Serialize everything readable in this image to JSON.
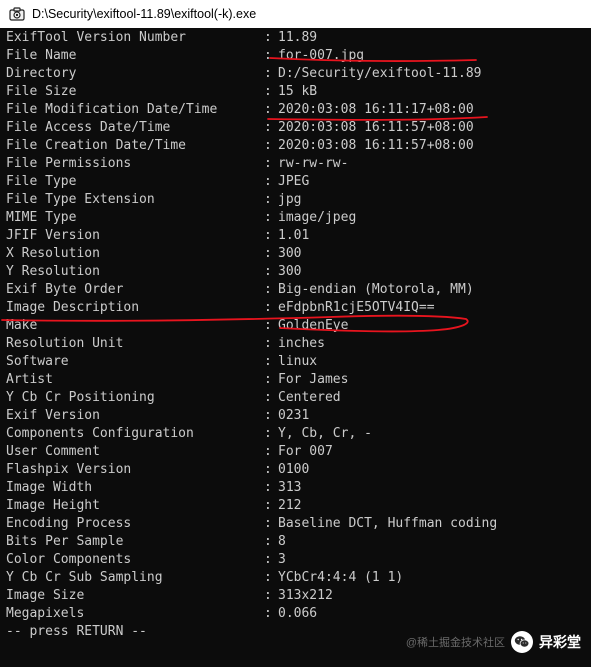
{
  "window": {
    "title": "D:\\Security\\exiftool-11.89\\exiftool(-k).exe",
    "icon": "camera-icon"
  },
  "console": {
    "background": "#0c0c0c",
    "text_color": "#cccccc",
    "separator": ":",
    "rows": [
      {
        "key": "ExifTool Version Number",
        "value": "11.89"
      },
      {
        "key": "File Name",
        "value": "for-007.jpg"
      },
      {
        "key": "Directory",
        "value": "D:/Security/exiftool-11.89"
      },
      {
        "key": "File Size",
        "value": "15 kB"
      },
      {
        "key": "File Modification Date/Time",
        "value": "2020:03:08 16:11:17+08:00"
      },
      {
        "key": "File Access Date/Time",
        "value": "2020:03:08 16:11:57+08:00"
      },
      {
        "key": "File Creation Date/Time",
        "value": "2020:03:08 16:11:57+08:00"
      },
      {
        "key": "File Permissions",
        "value": "rw-rw-rw-"
      },
      {
        "key": "File Type",
        "value": "JPEG"
      },
      {
        "key": "File Type Extension",
        "value": "jpg"
      },
      {
        "key": "MIME Type",
        "value": "image/jpeg"
      },
      {
        "key": "JFIF Version",
        "value": "1.01"
      },
      {
        "key": "X Resolution",
        "value": "300"
      },
      {
        "key": "Y Resolution",
        "value": "300"
      },
      {
        "key": "Exif Byte Order",
        "value": "Big-endian (Motorola, MM)"
      },
      {
        "key": "Image Description",
        "value": "eFdpbnR1cjE5OTV4IQ=="
      },
      {
        "key": "Make",
        "value": "GoldenEye"
      },
      {
        "key": "Resolution Unit",
        "value": "inches"
      },
      {
        "key": "Software",
        "value": "linux"
      },
      {
        "key": "Artist",
        "value": "For James"
      },
      {
        "key": "Y Cb Cr Positioning",
        "value": "Centered"
      },
      {
        "key": "Exif Version",
        "value": "0231"
      },
      {
        "key": "Components Configuration",
        "value": "Y, Cb, Cr, -"
      },
      {
        "key": "User Comment",
        "value": "For 007"
      },
      {
        "key": "Flashpix Version",
        "value": "0100"
      },
      {
        "key": "Image Width",
        "value": "313"
      },
      {
        "key": "Image Height",
        "value": "212"
      },
      {
        "key": "Encoding Process",
        "value": "Baseline DCT, Huffman coding"
      },
      {
        "key": "Bits Per Sample",
        "value": "8"
      },
      {
        "key": "Color Components",
        "value": "3"
      },
      {
        "key": "Y Cb Cr Sub Sampling",
        "value": "YCbCr4:4:4 (1 1)"
      },
      {
        "key": "Image Size",
        "value": "313x212"
      },
      {
        "key": "Megapixels",
        "value": "0.066"
      }
    ],
    "prompt": "-- press RETURN --"
  },
  "annotations": {
    "color": "#e8141e",
    "underlined_rows": [
      "File Name",
      "File Modification Date/Time",
      "Image Description"
    ]
  },
  "watermark": {
    "faint_text": "@稀土掘金技术社区",
    "logo_icon": "wechat-icon",
    "name": "异彩堂"
  }
}
